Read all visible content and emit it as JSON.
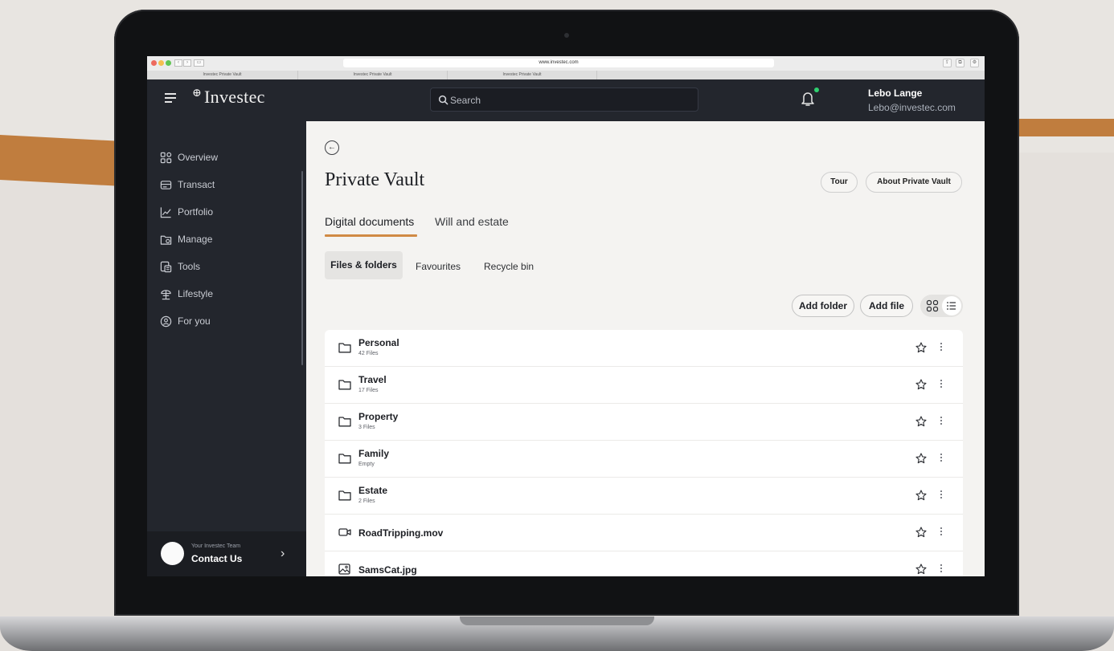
{
  "browser": {
    "url": "www.investec.com",
    "tabs": [
      "Investec Private Vault",
      "Investec Private Vault",
      "Investec Private Vault"
    ]
  },
  "header": {
    "brand": "Investec",
    "search_placeholder": "Search",
    "user_name": "Lebo Lange",
    "user_email": "Lebo@investec.com",
    "notification_dot_color": "#2fd06f"
  },
  "sidebar": {
    "items": [
      {
        "label": "Overview",
        "icon": "overview-icon"
      },
      {
        "label": "Transact",
        "icon": "transact-icon"
      },
      {
        "label": "Portfolio",
        "icon": "portfolio-icon"
      },
      {
        "label": "Manage",
        "icon": "manage-icon"
      },
      {
        "label": "Tools",
        "icon": "tools-icon"
      },
      {
        "label": "Lifestyle",
        "icon": "lifestyle-icon"
      },
      {
        "label": "For you",
        "icon": "for-you-icon"
      }
    ],
    "contact": {
      "subtitle": "Your Investec Team",
      "label": "Contact Us"
    }
  },
  "main": {
    "title": "Private Vault",
    "actions": {
      "tour": "Tour",
      "about": "About Private Vault"
    },
    "tabs": [
      {
        "label": "Digital documents",
        "active": true
      },
      {
        "label": "Will and estate",
        "active": false
      }
    ],
    "subtabs": [
      {
        "label": "Files & folders",
        "active": true
      },
      {
        "label": "Favourites",
        "active": false
      },
      {
        "label": "Recycle bin",
        "active": false
      }
    ],
    "add_folder": "Add folder",
    "add_file": "Add file",
    "accent_color": "#d08a45",
    "files": [
      {
        "name": "Personal",
        "meta": "42 Files",
        "type": "folder"
      },
      {
        "name": "Travel",
        "meta": "17 Files",
        "type": "folder"
      },
      {
        "name": "Property",
        "meta": "3 Files",
        "type": "folder"
      },
      {
        "name": "Family",
        "meta": "Empty",
        "type": "folder"
      },
      {
        "name": "Estate",
        "meta": "2 Files",
        "type": "folder"
      },
      {
        "name": "RoadTripping.mov",
        "meta": "",
        "type": "video"
      },
      {
        "name": "SamsCat.jpg",
        "meta": "",
        "type": "image"
      }
    ]
  }
}
